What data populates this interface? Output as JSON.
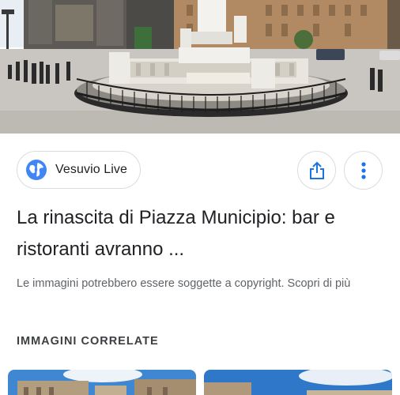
{
  "hero": {
    "image": "Piazza Municipio fountain with Castel Nuovo in background"
  },
  "source": {
    "label": "Vesuvio Live",
    "icon": "globe-icon"
  },
  "actions": {
    "share_icon": "share-icon",
    "more_icon": "more-vert-icon"
  },
  "title": "La rinascita di Piazza Municipio: bar e ristoranti avranno ...",
  "copyright": "Le immagini potrebbero essere soggette a copyright. Scopri di più",
  "related": {
    "heading": "IMMAGINI CORRELATE"
  },
  "colors": {
    "accent": "#1a73e8",
    "text_primary": "#202124",
    "text_secondary": "#5f6368",
    "border": "#dadce0"
  }
}
